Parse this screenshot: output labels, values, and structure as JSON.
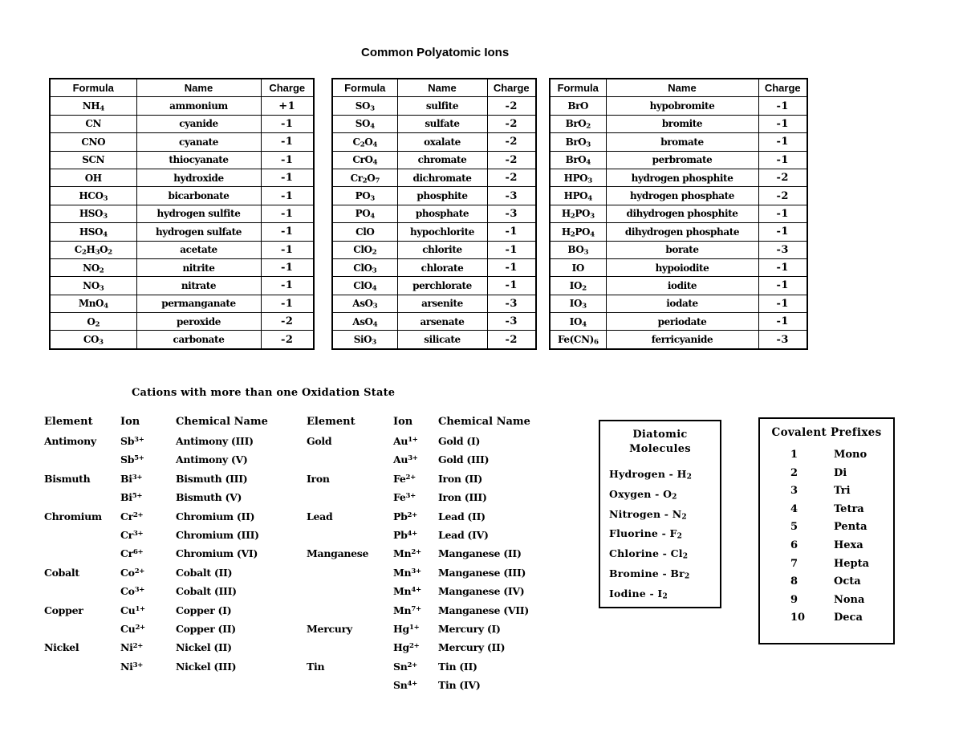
{
  "title": "Common Polyatomic Ions",
  "polyatomic": {
    "headers": [
      "Formula",
      "Name",
      "Charge"
    ],
    "tables": [
      {
        "rows": [
          {
            "formula": "NH<sub>4</sub>",
            "name": "ammonium",
            "charge": "+1"
          },
          {
            "formula": "CN",
            "name": "cyanide",
            "charge": "-1"
          },
          {
            "formula": "CNO",
            "name": "cyanate",
            "charge": "-1"
          },
          {
            "formula": "SCN",
            "name": "thiocyanate",
            "charge": "-1"
          },
          {
            "formula": "OH",
            "name": "hydroxide",
            "charge": "-1"
          },
          {
            "formula": "HCO<sub>3</sub>",
            "name": "bicarbonate",
            "charge": "-1"
          },
          {
            "formula": "HSO<sub>3</sub>",
            "name": "hydrogen sulfite",
            "charge": "-1"
          },
          {
            "formula": "HSO<sub>4</sub>",
            "name": "hydrogen sulfate",
            "charge": "-1"
          },
          {
            "formula": "C<sub>2</sub>H<sub>3</sub>O<sub>2</sub>",
            "name": "acetate",
            "charge": "-1"
          },
          {
            "formula": "NO<sub>2</sub>",
            "name": "nitrite",
            "charge": "-1"
          },
          {
            "formula": "NO<sub>3</sub>",
            "name": "nitrate",
            "charge": "-1"
          },
          {
            "formula": "MnO<sub>4</sub>",
            "name": "permanganate",
            "charge": "-1"
          },
          {
            "formula": "O<sub>2</sub>",
            "name": "peroxide",
            "charge": "-2"
          },
          {
            "formula": "CO<sub>3</sub>",
            "name": "carbonate",
            "charge": "-2"
          }
        ]
      },
      {
        "rows": [
          {
            "formula": "SO<sub>3</sub>",
            "name": "sulfite",
            "charge": "-2"
          },
          {
            "formula": "SO<sub>4</sub>",
            "name": "sulfate",
            "charge": "-2"
          },
          {
            "formula": "C<sub>2</sub>O<sub>4</sub>",
            "name": "oxalate",
            "charge": "-2"
          },
          {
            "formula": "CrO<sub>4</sub>",
            "name": "chromate",
            "charge": "-2"
          },
          {
            "formula": "Cr<sub>2</sub>O<sub>7</sub>",
            "name": "dichromate",
            "charge": "-2"
          },
          {
            "formula": "PO<sub>3</sub>",
            "name": "phosphite",
            "charge": "-3"
          },
          {
            "formula": "PO<sub>4</sub>",
            "name": "phosphate",
            "charge": "-3"
          },
          {
            "formula": "ClO",
            "name": "hypochlorite",
            "charge": "-1"
          },
          {
            "formula": "ClO<sub>2</sub>",
            "name": "chlorite",
            "charge": "-1"
          },
          {
            "formula": "ClO<sub>3</sub>",
            "name": "chlorate",
            "charge": "-1"
          },
          {
            "formula": "ClO<sub>4</sub>",
            "name": "perchlorate",
            "charge": "-1"
          },
          {
            "formula": "AsO<sub>3</sub>",
            "name": "arsenite",
            "charge": "-3"
          },
          {
            "formula": "AsO<sub>4</sub>",
            "name": "arsenate",
            "charge": "-3"
          },
          {
            "formula": "SiO<sub>3</sub>",
            "name": "silicate",
            "charge": "-2"
          }
        ]
      },
      {
        "rows": [
          {
            "formula": "BrO",
            "name": "hypobromite",
            "charge": "-1"
          },
          {
            "formula": "BrO<sub>2</sub>",
            "name": "bromite",
            "charge": "-1"
          },
          {
            "formula": "BrO<sub>3</sub>",
            "name": "bromate",
            "charge": "-1"
          },
          {
            "formula": "BrO<sub>4</sub>",
            "name": "perbromate",
            "charge": "-1"
          },
          {
            "formula": "HPO<sub>3</sub>",
            "name": "hydrogen phosphite",
            "charge": "-2"
          },
          {
            "formula": "HPO<sub>4</sub>",
            "name": "hydrogen phosphate",
            "charge": "-2"
          },
          {
            "formula": "H<sub>2</sub>PO<sub>3</sub>",
            "name": "dihydrogen phosphite",
            "charge": "-1"
          },
          {
            "formula": "H<sub>2</sub>PO<sub>4</sub>",
            "name": "dihydrogen phosphate",
            "charge": "-1"
          },
          {
            "formula": "BO<sub>3</sub>",
            "name": "borate",
            "charge": "-3"
          },
          {
            "formula": "IO",
            "name": "hypoiodite",
            "charge": "-1"
          },
          {
            "formula": "IO<sub>2</sub>",
            "name": "iodite",
            "charge": "-1"
          },
          {
            "formula": "IO<sub>3</sub>",
            "name": "iodate",
            "charge": "-1"
          },
          {
            "formula": "IO<sub>4</sub>",
            "name": "periodate",
            "charge": "-1"
          },
          {
            "formula": "Fe(CN)<sub>6</sub>",
            "name": "ferricyanide",
            "charge": "-3"
          }
        ]
      }
    ]
  },
  "cations": {
    "title": "Cations with more than one Oxidation State",
    "headers": [
      "Element",
      "Ion",
      "Chemical Name"
    ],
    "columns": [
      {
        "rows": [
          {
            "element": "Antimony",
            "ion": "Sb<sup>3+</sup>",
            "name": "Antimony (III)"
          },
          {
            "element": "",
            "ion": "Sb<sup>5+</sup>",
            "name": "Antimony (V)"
          },
          {
            "element": "Bismuth",
            "ion": "Bi<sup>3+</sup>",
            "name": "Bismuth (III)"
          },
          {
            "element": "",
            "ion": "Bi<sup>5+</sup>",
            "name": "Bismuth (V)"
          },
          {
            "element": "Chromium",
            "ion": "Cr<sup>2+</sup>",
            "name": "Chromium (II)"
          },
          {
            "element": "",
            "ion": "Cr<sup>3+</sup>",
            "name": "Chromium (III)"
          },
          {
            "element": "",
            "ion": "Cr<sup>6+</sup>",
            "name": "Chromium (VI)"
          },
          {
            "element": "Cobalt",
            "ion": "Co<sup>2+</sup>",
            "name": "Cobalt (II)"
          },
          {
            "element": "",
            "ion": "Co<sup>3+</sup>",
            "name": "Cobalt (III)"
          },
          {
            "element": "Copper",
            "ion": "Cu<sup>1+</sup>",
            "name": "Copper (I)"
          },
          {
            "element": "",
            "ion": "Cu<sup>2+</sup>",
            "name": "Copper (II)"
          },
          {
            "element": "Nickel",
            "ion": "Ni<sup>2+</sup>",
            "name": "Nickel (II)"
          },
          {
            "element": "",
            "ion": "Ni<sup>3+</sup>",
            "name": "Nickel (III)"
          }
        ]
      },
      {
        "rows": [
          {
            "element": "Gold",
            "ion": "Au<sup>1+</sup>",
            "name": "Gold (I)"
          },
          {
            "element": "",
            "ion": "Au<sup>3+</sup>",
            "name": "Gold (III)"
          },
          {
            "element": "Iron",
            "ion": "Fe<sup>2+</sup>",
            "name": "Iron (II)"
          },
          {
            "element": "",
            "ion": "Fe<sup>3+</sup>",
            "name": "Iron (III)"
          },
          {
            "element": "Lead",
            "ion": "Pb<sup>2+</sup>",
            "name": "Lead (II)"
          },
          {
            "element": "",
            "ion": "Pb<sup>4+</sup>",
            "name": "Lead (IV)"
          },
          {
            "element": "Manganese",
            "ion": "Mn<sup>2+</sup>",
            "name": "Manganese (II)"
          },
          {
            "element": "",
            "ion": "Mn<sup>3+</sup>",
            "name": "Manganese (III)"
          },
          {
            "element": "",
            "ion": "Mn<sup>4+</sup>",
            "name": "Manganese (IV)"
          },
          {
            "element": "",
            "ion": "Mn<sup>7+</sup>",
            "name": "Manganese (VII)"
          },
          {
            "element": "Mercury",
            "ion": "Hg<sup>1+</sup>",
            "name": "Mercury (I)"
          },
          {
            "element": "",
            "ion": "Hg<sup>2+</sup>",
            "name": "Mercury (II)"
          },
          {
            "element": "Tin",
            "ion": "Sn<sup>2+</sup>",
            "name": "Tin (II)"
          },
          {
            "element": "",
            "ion": "Sn<sup>4+</sup>",
            "name": "Tin (IV)"
          }
        ]
      }
    ]
  },
  "diatomic": {
    "title_line1": "Diatomic",
    "title_line2": "Molecules",
    "items": [
      "Hydrogen - H<sub>2</sub>",
      "Oxygen - O<sub>2</sub>",
      "Nitrogen - N<sub>2</sub>",
      "Fluorine - F<sub>2</sub>",
      "Chlorine - Cl<sub>2</sub>",
      "Bromine - Br<sub>2</sub>",
      "Iodine - I<sub>2</sub>"
    ]
  },
  "prefixes": {
    "title": "Covalent Prefixes",
    "items": [
      {
        "number": "1",
        "prefix": "Mono"
      },
      {
        "number": "2",
        "prefix": "Di"
      },
      {
        "number": "3",
        "prefix": "Tri"
      },
      {
        "number": "4",
        "prefix": "Tetra"
      },
      {
        "number": "5",
        "prefix": "Penta"
      },
      {
        "number": "6",
        "prefix": "Hexa"
      },
      {
        "number": "7",
        "prefix": "Hepta"
      },
      {
        "number": "8",
        "prefix": "Octa"
      },
      {
        "number": "9",
        "prefix": "Nona"
      },
      {
        "number": "10",
        "prefix": "Deca"
      }
    ]
  }
}
